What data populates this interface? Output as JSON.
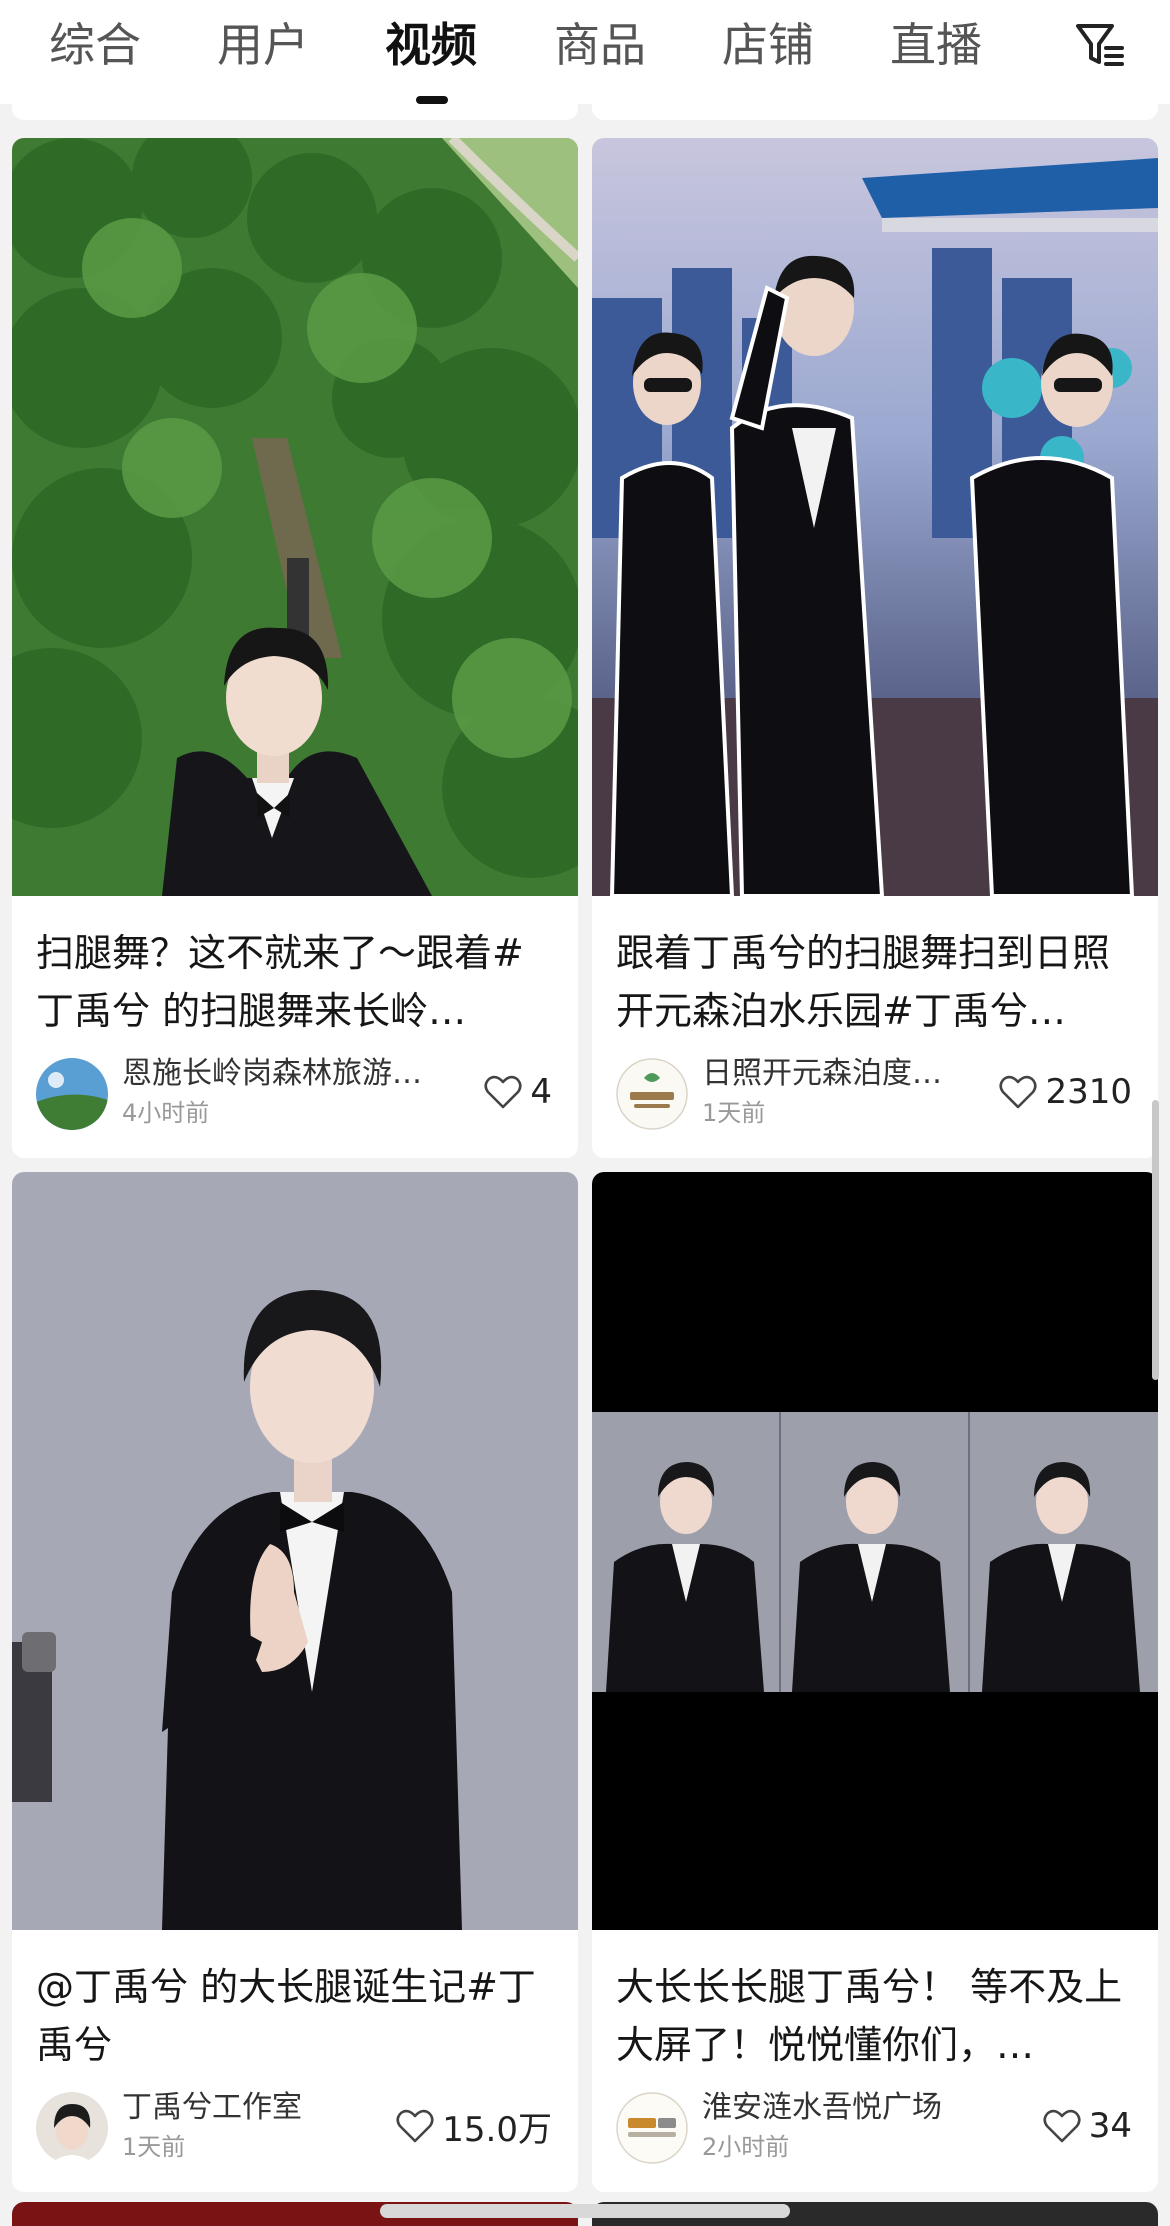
{
  "tabs": [
    {
      "label": "综合",
      "active": false
    },
    {
      "label": "用户",
      "active": false
    },
    {
      "label": "视频",
      "active": true
    },
    {
      "label": "商品",
      "active": false
    },
    {
      "label": "店铺",
      "active": false
    },
    {
      "label": "直播",
      "active": false
    }
  ],
  "filter_icon": "filter-icon",
  "cards": [
    {
      "title": "扫腿舞？这不就来了～跟着#丁禹兮 的扫腿舞来长岭…",
      "author": "恩施长岭岗森林旅游…",
      "time": "4小时前",
      "likes": "4",
      "thumb": "forest-scene"
    },
    {
      "title": "跟着丁禹兮的扫腿舞扫到日照开元森泊水乐园#丁禹兮…",
      "author": "日照开元森泊度…",
      "time": "1天前",
      "likes": "2310",
      "thumb": "waterpark-scene"
    },
    {
      "title": "@丁禹兮 的大长腿诞生记#丁禹兮",
      "author": "丁禹兮工作室",
      "time": "1天前",
      "likes": "15.0万",
      "thumb": "portrait-scene"
    },
    {
      "title": "大长长长腿丁禹兮！ 等不及上大屏了！悦悦懂你们，…",
      "author": "淮安涟水吾悦广场",
      "time": "2小时前",
      "likes": "34",
      "thumb": "triple-portrait-scene"
    }
  ],
  "colors": {
    "background": "#f2f2f2",
    "card": "#ffffff",
    "text_primary": "#161616",
    "text_secondary": "#999999"
  }
}
